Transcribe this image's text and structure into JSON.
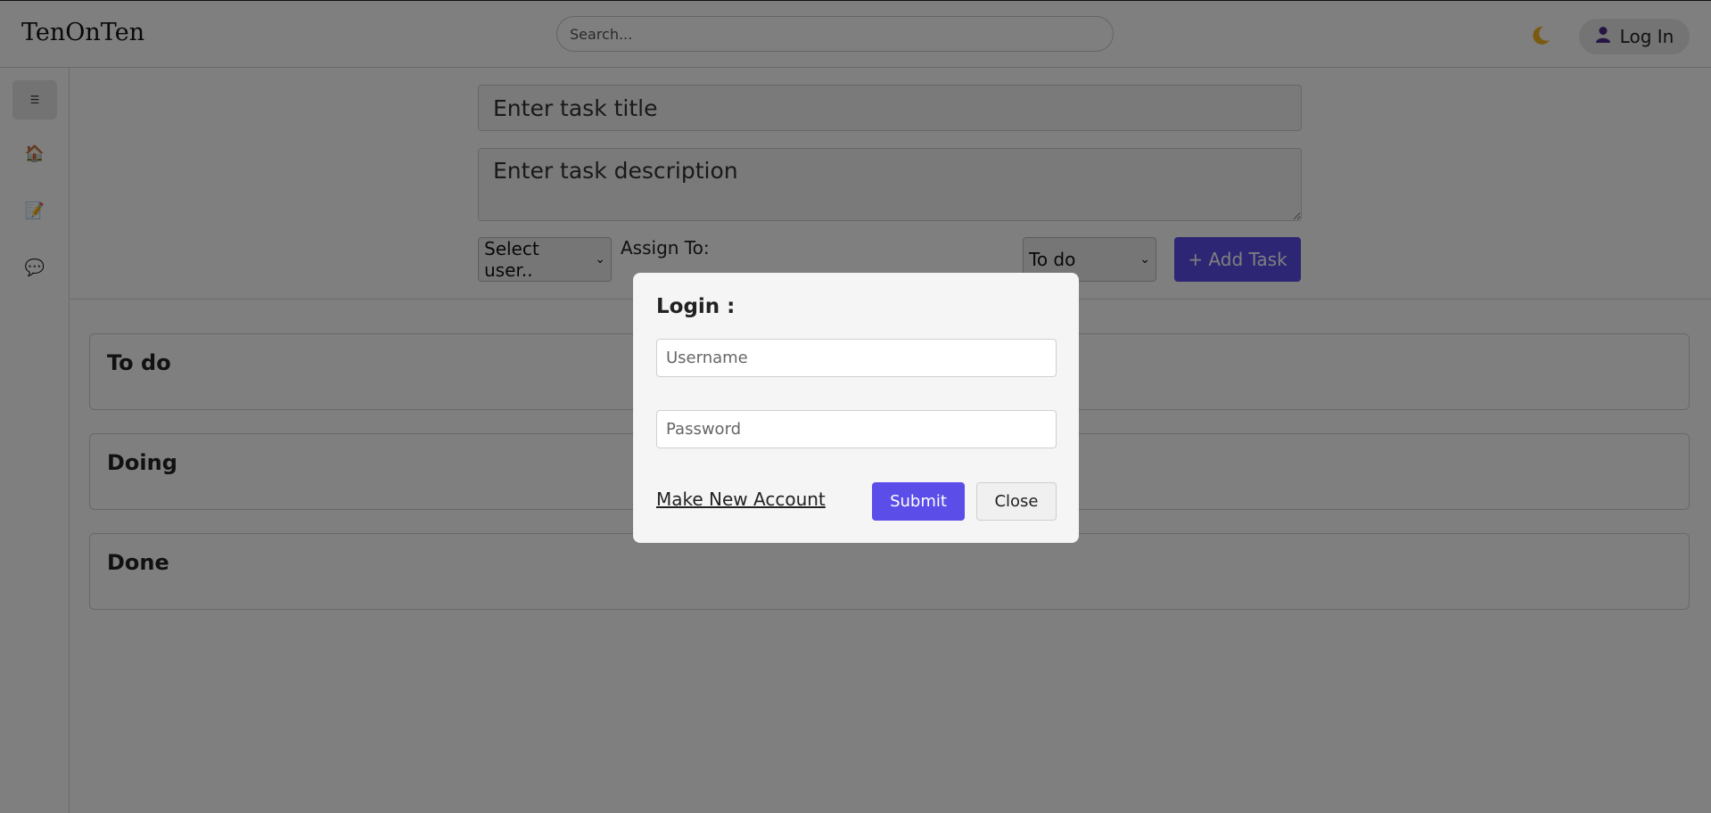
{
  "header": {
    "brand": "TenOnTen",
    "search_placeholder": "Search...",
    "theme_icon": "moon-icon",
    "login_label": "Log In",
    "login_icon": "user-icon"
  },
  "sidebar": {
    "menu_icon": "hamburger-icon",
    "items": [
      {
        "name": "home",
        "icon": "house-icon"
      },
      {
        "name": "notes",
        "icon": "memo-icon"
      },
      {
        "name": "chat",
        "icon": "speech-bubble-icon"
      }
    ]
  },
  "task_form": {
    "title_placeholder": "Enter task title",
    "description_placeholder": "Enter task description",
    "user_select_value": "Select user..",
    "assign_label": "Assign To:",
    "status_select_value": "To do",
    "add_task_label": "+ Add Task"
  },
  "columns": [
    {
      "title": "To do"
    },
    {
      "title": "Doing"
    },
    {
      "title": "Done"
    }
  ],
  "login_modal": {
    "title": "Login :",
    "username_placeholder": "Username",
    "password_placeholder": "Password",
    "new_account_label": "Make New Account",
    "submit_label": "Submit",
    "close_label": "Close"
  },
  "colors": {
    "accent": "#5b4de8",
    "overlay": "rgba(0,0,0,0.5)"
  }
}
